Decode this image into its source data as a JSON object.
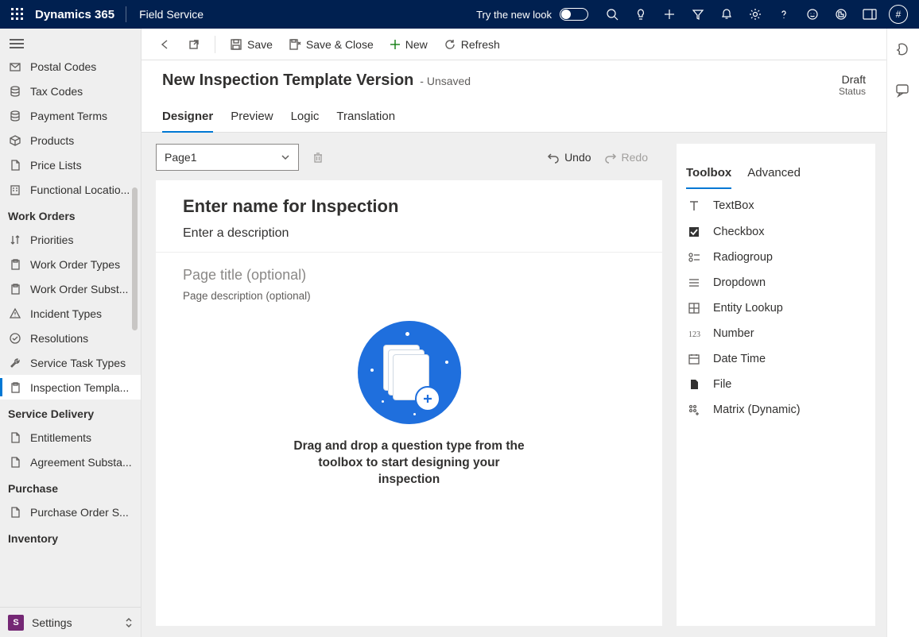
{
  "navbar": {
    "brand": "Dynamics 365",
    "app_name": "Field Service",
    "try_new_label": "Try the new look",
    "avatar_initial": "#"
  },
  "sidebar": {
    "items_top": [
      {
        "icon": "mail",
        "label": "Postal Codes"
      },
      {
        "icon": "stack",
        "label": "Tax Codes"
      },
      {
        "icon": "stack",
        "label": "Payment Terms"
      },
      {
        "icon": "cube",
        "label": "Products"
      },
      {
        "icon": "doc",
        "label": "Price Lists"
      },
      {
        "icon": "building",
        "label": "Functional Locatio..."
      }
    ],
    "groups": [
      {
        "header": "Work Orders",
        "items": [
          {
            "icon": "sort",
            "label": "Priorities"
          },
          {
            "icon": "clipboard",
            "label": "Work Order Types"
          },
          {
            "icon": "clipboard",
            "label": "Work Order Subst..."
          },
          {
            "icon": "warning",
            "label": "Incident Types"
          },
          {
            "icon": "check",
            "label": "Resolutions"
          },
          {
            "icon": "wrench",
            "label": "Service Task Types"
          },
          {
            "icon": "clipboard",
            "label": "Inspection Templa...",
            "active": true
          }
        ]
      },
      {
        "header": "Service Delivery",
        "items": [
          {
            "icon": "doc",
            "label": "Entitlements"
          },
          {
            "icon": "doc",
            "label": "Agreement Substa..."
          }
        ]
      },
      {
        "header": "Purchase",
        "items": [
          {
            "icon": "doc",
            "label": "Purchase Order S..."
          }
        ]
      },
      {
        "header": "Inventory",
        "items": []
      }
    ],
    "area": {
      "initial": "S",
      "label": "Settings"
    }
  },
  "commandbar": {
    "back": "",
    "popout": "",
    "save": "Save",
    "save_close": "Save & Close",
    "new": "New",
    "refresh": "Refresh"
  },
  "form": {
    "title": "New Inspection Template Version",
    "subtitle": "- Unsaved",
    "status_value": "Draft",
    "status_label": "Status",
    "tabs": [
      "Designer",
      "Preview",
      "Logic",
      "Translation"
    ],
    "active_tab": "Designer"
  },
  "designer": {
    "page_selector": "Page1",
    "undo": "Undo",
    "redo": "Redo",
    "canvas": {
      "name_placeholder": "Enter name for Inspection",
      "desc_placeholder": "Enter a description",
      "page_title_placeholder": "Page title (optional)",
      "page_desc_placeholder": "Page description (optional)",
      "empty_hint": "Drag and drop a question type from the toolbox to start designing your inspection"
    },
    "right_panel": {
      "tabs": [
        "Toolbox",
        "Advanced"
      ],
      "active": "Toolbox",
      "toolbox": [
        {
          "icon": "text",
          "label": "TextBox"
        },
        {
          "icon": "checkbox",
          "label": "Checkbox"
        },
        {
          "icon": "radio",
          "label": "Radiogroup"
        },
        {
          "icon": "dropdown",
          "label": "Dropdown"
        },
        {
          "icon": "grid",
          "label": "Entity Lookup"
        },
        {
          "icon": "number",
          "label": "Number"
        },
        {
          "icon": "calendar",
          "label": "Date Time"
        },
        {
          "icon": "file",
          "label": "File"
        },
        {
          "icon": "matrix",
          "label": "Matrix (Dynamic)"
        }
      ]
    }
  }
}
